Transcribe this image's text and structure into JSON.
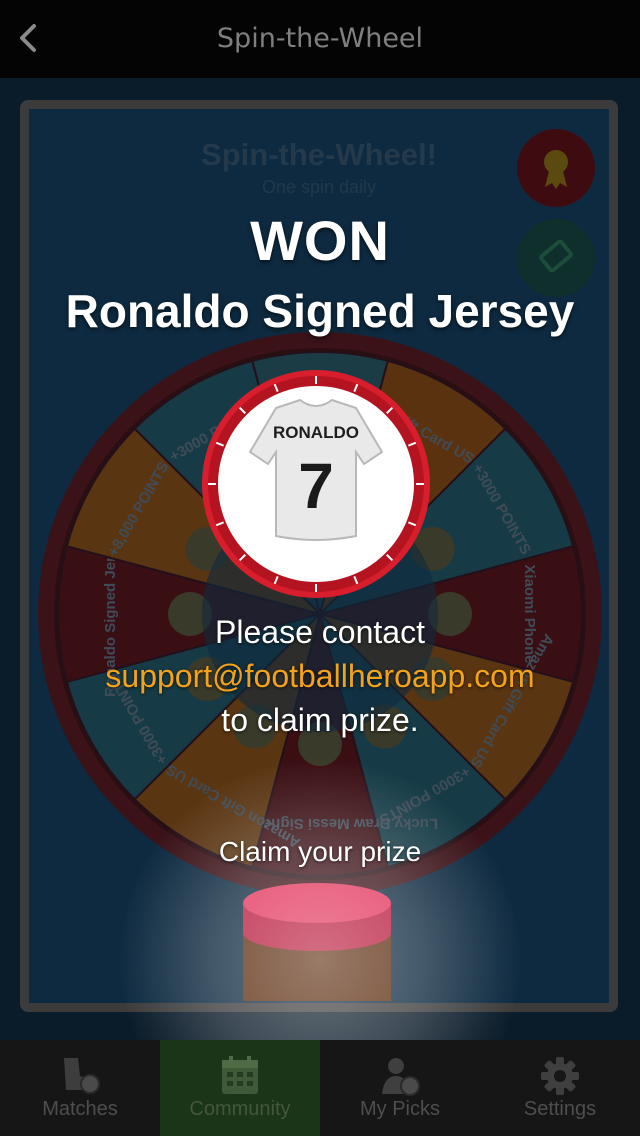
{
  "nav": {
    "title": "Spin-the-Wheel"
  },
  "wheel_card": {
    "title": "Spin-the-Wheel!",
    "subtitle": "One spin daily",
    "segments": [
      {
        "label": "+3000 POINTS",
        "color": "#1b3b45"
      },
      {
        "label": "Amazon Gift Card US$ 1.00",
        "color": "#5a3210"
      },
      {
        "label": "+3000 POINTS",
        "color": "#163b46"
      },
      {
        "label": "Xiaomi Phone",
        "color": "#3a0f14"
      },
      {
        "label": "Amazon Gift Card US$ 1.00",
        "color": "#5a3512"
      },
      {
        "label": "+3000 POINTS",
        "color": "#163b46"
      },
      {
        "label": "Lucky Draw Messi Signed Jersey",
        "color": "#3a0f14"
      },
      {
        "label": "Amazon Gift Card US$ 5.00",
        "color": "#5a3512"
      },
      {
        "label": "+3000 POINTS",
        "color": "#163b46"
      },
      {
        "label": "Ronaldo Signed Jersey",
        "color": "#3a0f14"
      },
      {
        "label": "+8,000 POINTS",
        "color": "#5a3512"
      },
      {
        "label": "+3000 POINTS",
        "color": "#163b46"
      }
    ]
  },
  "result": {
    "headline": "WON",
    "prize": "Ronaldo Signed Jersey",
    "jersey_name": "RONALDO",
    "jersey_number": "7",
    "line1": "Please contact",
    "email": "support@footballheroapp.com",
    "line3": "to claim prize.",
    "claim_label": "Claim your prize"
  },
  "colors": {
    "accent": "#f4a21a",
    "claim_button": "#d8274a",
    "medal_ring": "#d81e2d"
  },
  "tabs": [
    {
      "label": "Matches",
      "icon": "boot-ball-icon",
      "active": false
    },
    {
      "label": "Community",
      "icon": "calendar-icon",
      "active": true
    },
    {
      "label": "My Picks",
      "icon": "person-ball-icon",
      "active": false
    },
    {
      "label": "Settings",
      "icon": "gear-icon",
      "active": false
    }
  ]
}
